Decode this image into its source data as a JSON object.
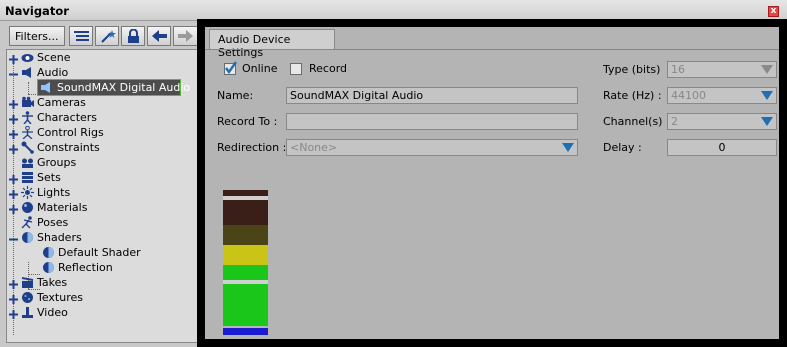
{
  "window": {
    "title": "Navigator",
    "close_glyph": "x"
  },
  "toolbar": {
    "filters_label": "Filters...",
    "icons": [
      "list-icon",
      "magic-wand-icon",
      "lock-icon",
      "back-arrow-icon",
      "forward-arrow-icon"
    ]
  },
  "tree": {
    "items": [
      {
        "label": "Scene",
        "icon": "scene-icon",
        "expander": "+"
      },
      {
        "label": "Audio",
        "icon": "speaker-icon",
        "expander": "-"
      },
      {
        "label": "SoundMAX Digital Audio",
        "icon": "speaker-icon",
        "expander": "",
        "selected": true
      },
      {
        "label": "Cameras",
        "icon": "camera-icon",
        "expander": "+"
      },
      {
        "label": "Characters",
        "icon": "character-icon",
        "expander": "+"
      },
      {
        "label": "Control Rigs",
        "icon": "control-rig-icon",
        "expander": "+"
      },
      {
        "label": "Constraints",
        "icon": "constraint-icon",
        "expander": "+"
      },
      {
        "label": "Groups",
        "icon": "groups-icon",
        "expander": ""
      },
      {
        "label": "Sets",
        "icon": "sets-icon",
        "expander": "+"
      },
      {
        "label": "Lights",
        "icon": "light-icon",
        "expander": "+"
      },
      {
        "label": "Materials",
        "icon": "material-icon",
        "expander": "+"
      },
      {
        "label": "Poses",
        "icon": "pose-icon",
        "expander": ""
      },
      {
        "label": "Shaders",
        "icon": "shader-icon",
        "expander": "-"
      },
      {
        "label": "Default Shader",
        "icon": "shader-icon",
        "expander": ""
      },
      {
        "label": "Reflection",
        "icon": "shader-icon",
        "expander": ""
      },
      {
        "label": "Takes",
        "icon": "takes-icon",
        "expander": "+"
      },
      {
        "label": "Textures",
        "icon": "texture-icon",
        "expander": "+"
      },
      {
        "label": "Video",
        "icon": "video-icon",
        "expander": "+"
      }
    ]
  },
  "settings": {
    "tab_label": "Audio Device Settings",
    "online_label": "Online",
    "online_checked": true,
    "record_label": "Record",
    "record_checked": false,
    "name_label": "Name:",
    "name_value": "SoundMAX Digital Audio",
    "record_to_label": "Record To :",
    "record_to_value": "",
    "redirection_label": "Redirection :",
    "redirection_value": "<None>",
    "type_label": "Type (bits)",
    "type_value": "16",
    "rate_label": "Rate (Hz) :",
    "rate_value": "44100",
    "channels_label": "Channel(s)",
    "channels_value": "2",
    "delay_label": "Delay :",
    "delay_value": "0"
  },
  "colors": {
    "accent_blue": "#1f6fb3",
    "selection_outline": "#5cb83a",
    "meter_top_dark": "#3a1f18",
    "meter_olive": "#4a4417",
    "meter_yellow": "#c9c416",
    "meter_green": "#1ac61a",
    "meter_blue": "#1b1bd0"
  }
}
